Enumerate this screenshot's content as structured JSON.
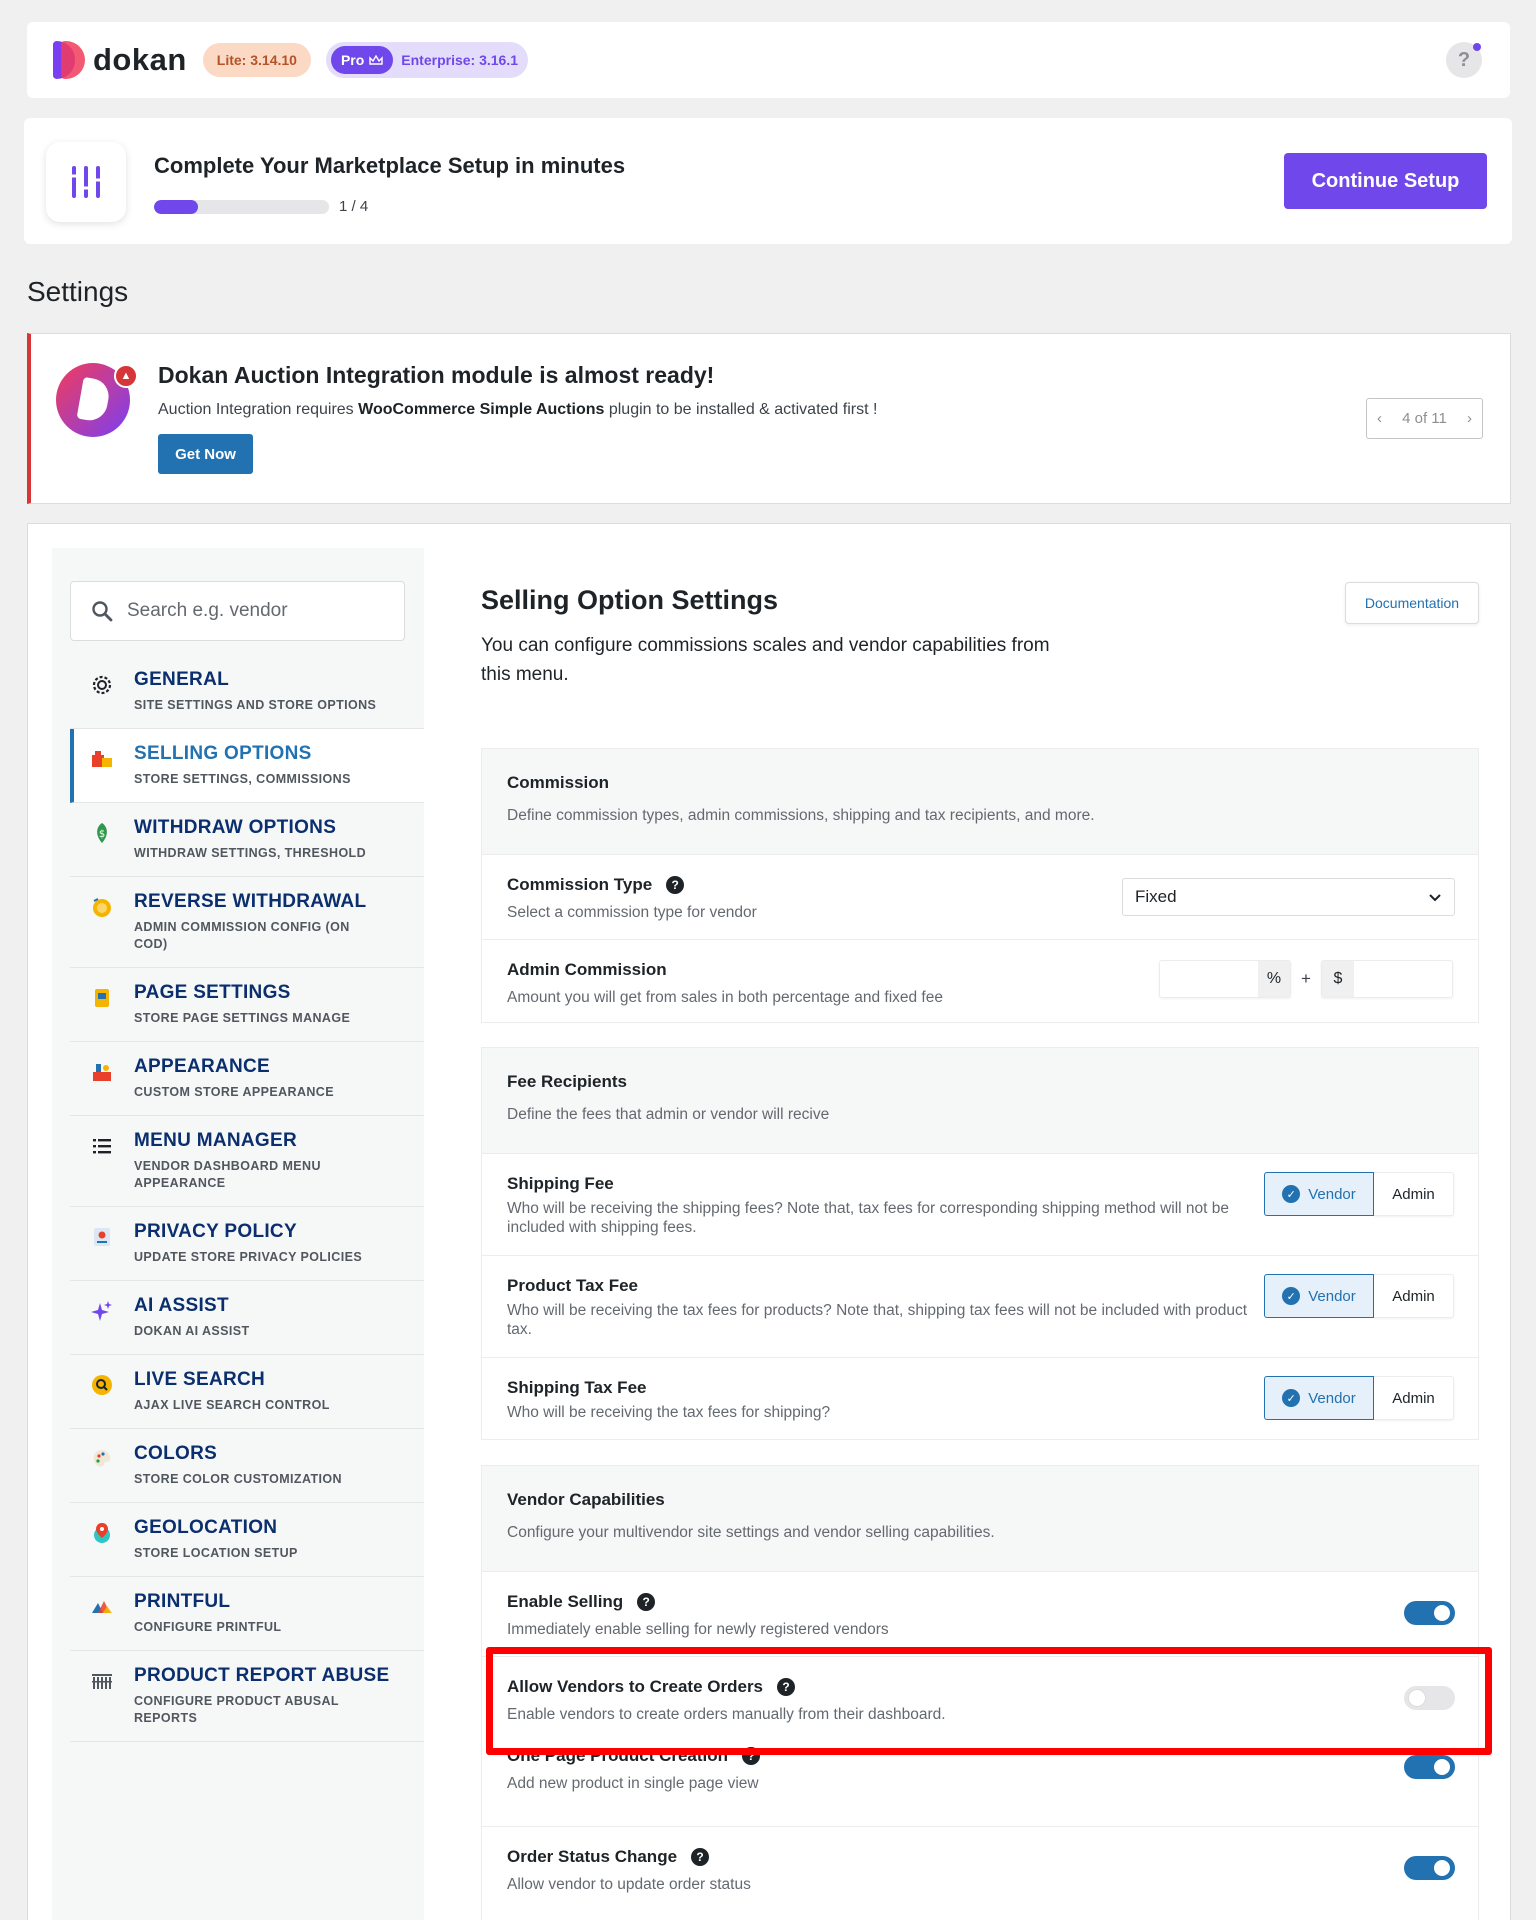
{
  "header": {
    "logo_text": "dokan",
    "lite_badge": "Lite: 3.14.10",
    "pro_badge": "Pro",
    "enterprise_badge": "Enterprise: 3.16.1",
    "help_label": "?"
  },
  "setup": {
    "title": "Complete Your Marketplace Setup in minutes",
    "progress_text": "1 / 4",
    "progress_fraction": 0.25,
    "button": "Continue Setup"
  },
  "page_title": "Settings",
  "notice": {
    "title": "Dokan Auction Integration module is almost ready!",
    "text_before": "Auction Integration requires ",
    "text_bold": "WooCommerce Simple Auctions",
    "text_after": " plugin to be installed & activated first !",
    "button": "Get Now",
    "pager": "4 of 11"
  },
  "search": {
    "placeholder": "Search e.g. vendor"
  },
  "sidebar": {
    "items": [
      {
        "title": "GENERAL",
        "subtitle": "SITE SETTINGS AND STORE OPTIONS",
        "icon": "gear-icon"
      },
      {
        "title": "SELLING OPTIONS",
        "subtitle": "STORE SETTINGS, COMMISSIONS",
        "icon": "store-icon"
      },
      {
        "title": "WITHDRAW OPTIONS",
        "subtitle": "WITHDRAW SETTINGS, THRESHOLD",
        "icon": "money-icon"
      },
      {
        "title": "REVERSE WITHDRAWAL",
        "subtitle": "ADMIN COMMISSION CONFIG (ON COD)",
        "icon": "coin-icon"
      },
      {
        "title": "PAGE SETTINGS",
        "subtitle": "STORE PAGE SETTINGS MANAGE",
        "icon": "page-icon"
      },
      {
        "title": "APPEARANCE",
        "subtitle": "CUSTOM STORE APPEARANCE",
        "icon": "appearance-icon"
      },
      {
        "title": "MENU MANAGER",
        "subtitle": "VENDOR DASHBOARD MENU APPEARANCE",
        "icon": "list-icon"
      },
      {
        "title": "PRIVACY POLICY",
        "subtitle": "UPDATE STORE PRIVACY POLICIES",
        "icon": "privacy-icon"
      },
      {
        "title": "AI ASSIST",
        "subtitle": "DOKAN AI ASSIST",
        "icon": "sparkle-icon"
      },
      {
        "title": "LIVE SEARCH",
        "subtitle": "AJAX LIVE SEARCH CONTROL",
        "icon": "magnifier-icon"
      },
      {
        "title": "COLORS",
        "subtitle": "STORE COLOR CUSTOMIZATION",
        "icon": "palette-icon"
      },
      {
        "title": "GEOLOCATION",
        "subtitle": "STORE LOCATION SETUP",
        "icon": "location-icon"
      },
      {
        "title": "PRINTFUL",
        "subtitle": "CONFIGURE PRINTFUL",
        "icon": "printful-icon"
      },
      {
        "title": "PRODUCT REPORT ABUSE",
        "subtitle": "CONFIGURE PRODUCT ABUSAL REPORTS",
        "icon": "report-icon"
      }
    ]
  },
  "content": {
    "title": "Selling Option Settings",
    "description": "You can configure commissions scales and vendor capabilities from this menu.",
    "documentation": "Documentation"
  },
  "commission": {
    "title": "Commission",
    "description": "Define commission types, admin commissions, shipping and tax recipients, and more.",
    "type_label": "Commission Type",
    "type_desc": "Select a commission type for vendor",
    "type_value": "Fixed",
    "admin_label": "Admin Commission",
    "admin_desc": "Amount you will get from sales in both percentage and fixed fee",
    "percent_symbol": "%",
    "plus": "+",
    "dollar_symbol": "$"
  },
  "fees": {
    "title": "Fee Recipients",
    "description": "Define the fees that admin or vendor will recive",
    "vendor_label": "Vendor",
    "admin_label": "Admin",
    "rows": [
      {
        "title": "Shipping Fee",
        "desc": "Who will be receiving the shipping fees? Note that, tax fees for corresponding shipping method will not be included with shipping fees.",
        "selected": "Vendor"
      },
      {
        "title": "Product Tax Fee",
        "desc": "Who will be receiving the tax fees for products? Note that, shipping tax fees will not be included with product tax.",
        "selected": "Vendor"
      },
      {
        "title": "Shipping Tax Fee",
        "desc": "Who will be receiving the tax fees for shipping?",
        "selected": "Vendor"
      }
    ]
  },
  "capabilities": {
    "title": "Vendor Capabilities",
    "description": "Configure your multivendor site settings and vendor selling capabilities.",
    "rows": [
      {
        "title": "Enable Selling",
        "desc": "Immediately enable selling for newly registered vendors",
        "enabled": true
      },
      {
        "title": "Allow Vendors to Create Orders",
        "desc": "Enable vendors to create orders manually from their dashboard.",
        "enabled": false
      },
      {
        "title": "One Page Product Creation",
        "desc": "Add new product in single page view",
        "enabled": true
      },
      {
        "title": "Order Status Change",
        "desc": "Allow vendor to update order status",
        "enabled": true
      }
    ]
  },
  "colors": {
    "accent": "#7047eb",
    "primary": "#2271b1",
    "highlight": "#ff0000"
  }
}
